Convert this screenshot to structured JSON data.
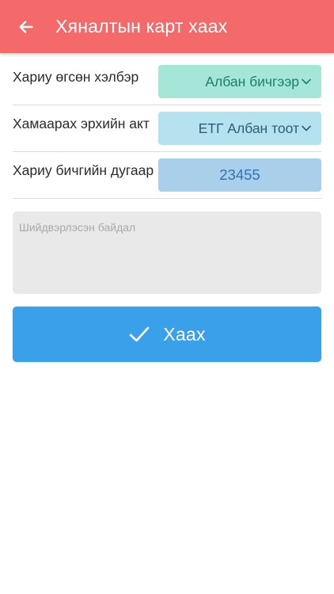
{
  "appbar": {
    "title": "Хяналтын карт хаах",
    "back_icon": "arrow-left-icon",
    "background": "#f46a6a"
  },
  "form": {
    "response_form": {
      "label": "Хариу өгсөн хэлбэр",
      "value": "Албан бичгээр",
      "icon": "chevron-down-icon",
      "color": "#a6e6d8"
    },
    "legal_act": {
      "label": "Хамаарах эрхийн акт",
      "value": "ЕТГ Албан тоот",
      "icon": "chevron-down-icon",
      "color": "#b5e2ee"
    },
    "response_number": {
      "label": "Хариу бичгийн дугаар",
      "value": "23455",
      "color": "#a9cfeb"
    },
    "resolution": {
      "placeholder": "Шийдвэрлэсэн байдал",
      "value": ""
    }
  },
  "actions": {
    "close_label": "Хаах",
    "close_icon": "check-icon",
    "color": "#3aa0ea"
  }
}
